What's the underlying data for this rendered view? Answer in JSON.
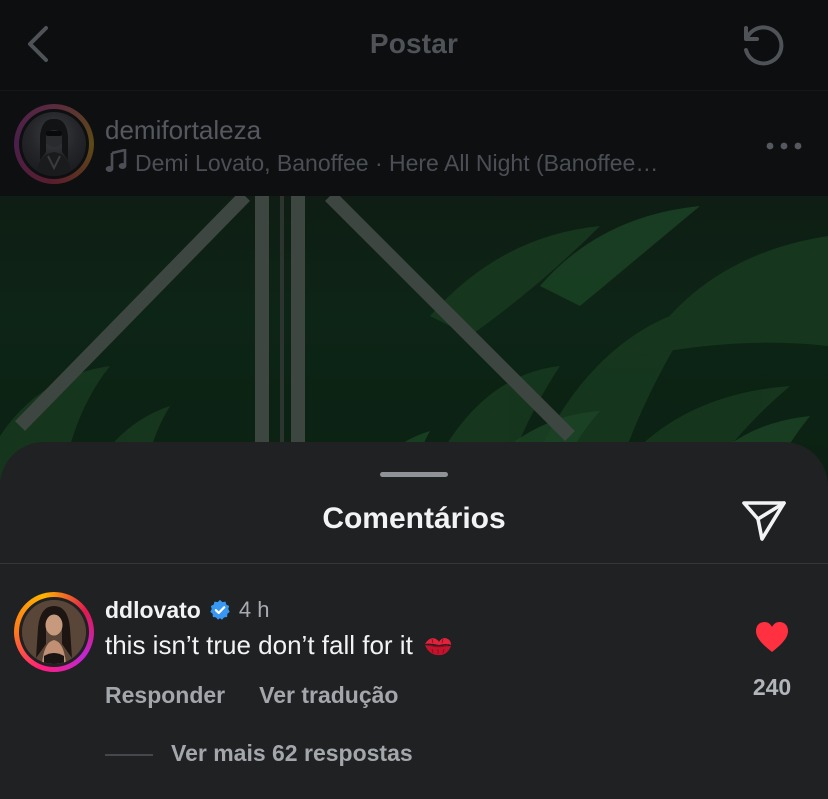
{
  "header": {
    "title": "Postar",
    "back_icon": "chevron-left-icon",
    "refresh_icon": "refresh-icon"
  },
  "post": {
    "username": "demifortaleza",
    "music": "Demi Lovato, Banoffee · Here All Night (Banoffee…",
    "music_icon": "music-note-icon",
    "more_icon": "more-horizontal-icon"
  },
  "comments_sheet": {
    "title": "Comentários",
    "share_icon": "send-icon",
    "comment": {
      "username": "ddlovato",
      "verified": true,
      "time": "4 h",
      "text": "this isn’t true don’t fall for it",
      "emoji": "kiss-mark-emoji",
      "reply_label": "Responder",
      "translate_label": "Ver tradução",
      "likes": "240",
      "liked": true,
      "view_replies_label": "Ver mais 62 respostas"
    }
  },
  "colors": {
    "sheet_bg": "#1f2123",
    "like_red": "#ff3040",
    "verified_blue": "#3897f0",
    "story_ring_start": "#ff1f7a",
    "story_ring_end": "#ffb300"
  }
}
